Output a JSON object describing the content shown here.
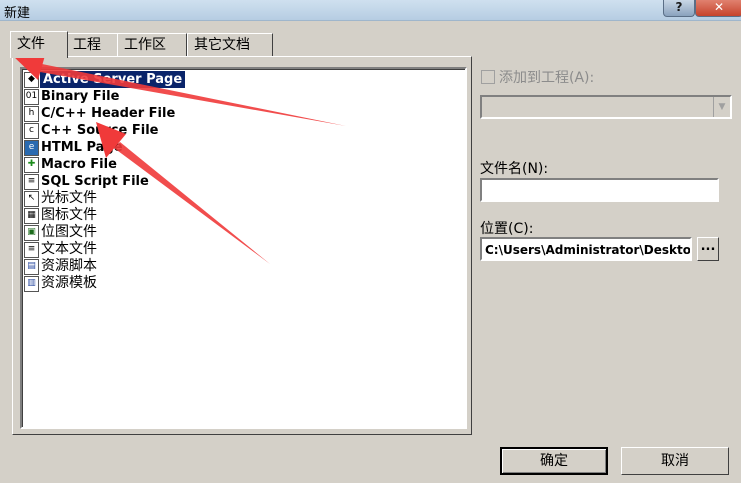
{
  "window": {
    "title": "新建",
    "help": "?",
    "close": "✕"
  },
  "tabs": [
    {
      "label": "文件",
      "active": true
    },
    {
      "label": "工程"
    },
    {
      "label": "工作区"
    },
    {
      "label": "其它文档"
    }
  ],
  "files": [
    {
      "label": "Active Server Page",
      "icon": "asp-file-icon",
      "selected": true
    },
    {
      "label": "Binary File",
      "icon": "binary-file-icon"
    },
    {
      "label": "C/C++ Header File",
      "icon": "header-file-icon"
    },
    {
      "label": "C++ Source File",
      "icon": "source-file-icon"
    },
    {
      "label": "HTML Page",
      "icon": "html-page-icon"
    },
    {
      "label": "Macro File",
      "icon": "macro-file-icon"
    },
    {
      "label": "SQL Script File",
      "icon": "sql-file-icon"
    },
    {
      "label": "光标文件",
      "icon": "cursor-file-icon"
    },
    {
      "label": "图标文件",
      "icon": "icon-file-icon"
    },
    {
      "label": "位图文件",
      "icon": "bitmap-file-icon"
    },
    {
      "label": "文本文件",
      "icon": "text-file-icon"
    },
    {
      "label": "资源脚本",
      "icon": "resource-script-icon"
    },
    {
      "label": "资源模板",
      "icon": "resource-template-icon"
    }
  ],
  "add_to_project": {
    "label": "添加到工程(A):",
    "checked": false
  },
  "project_select": {
    "value": ""
  },
  "filename": {
    "label": "文件名(N):",
    "value": ""
  },
  "location": {
    "label": "位置(C):",
    "value": "C:\\Users\\Administrator\\Desktop",
    "browse": "..."
  },
  "buttons": {
    "ok": "确定",
    "cancel": "取消"
  },
  "colors": {
    "selection": "#0a246a",
    "dialog_bg": "#d4d0c8",
    "annotation_arrow": "#f03a3a"
  }
}
